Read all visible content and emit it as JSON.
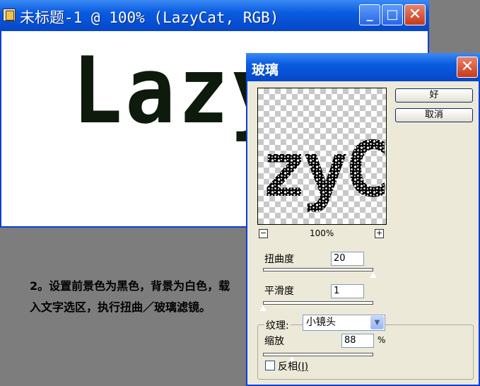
{
  "document": {
    "title": "未标题-1 @ 100% (LazyCat, RGB)",
    "canvas_text": "LazyCat",
    "buttons": {
      "minimize": "_",
      "maximize": "□",
      "close": "✕"
    }
  },
  "instruction": "2。设置前景色为黑色，背景为白色，载入文字选区，执行扭曲／玻璃滤镜。",
  "dialog": {
    "title": "玻璃",
    "close": "✕",
    "ok_label": "好",
    "cancel_label": "取消",
    "preview_text": "zyC",
    "zoom": {
      "minus": "−",
      "plus": "+",
      "level": "100%"
    },
    "distortion": {
      "label": "扭曲度",
      "value": "20",
      "fraction": 1.0
    },
    "smoothness": {
      "label": "平滑度",
      "value": "1",
      "fraction": 0.0
    },
    "texture": {
      "label": "纹理:",
      "selected": "小镜头"
    },
    "scaling": {
      "label": "缩放",
      "value": "88",
      "unit": "%",
      "fraction": 0.26
    },
    "invert": {
      "label": "反相",
      "mnemonic": "(I)",
      "checked": false
    }
  },
  "colors": {
    "titlebar": "#0a5be0",
    "dialog_bg": "#ece9d8",
    "workspace": "#7d7d7d"
  }
}
